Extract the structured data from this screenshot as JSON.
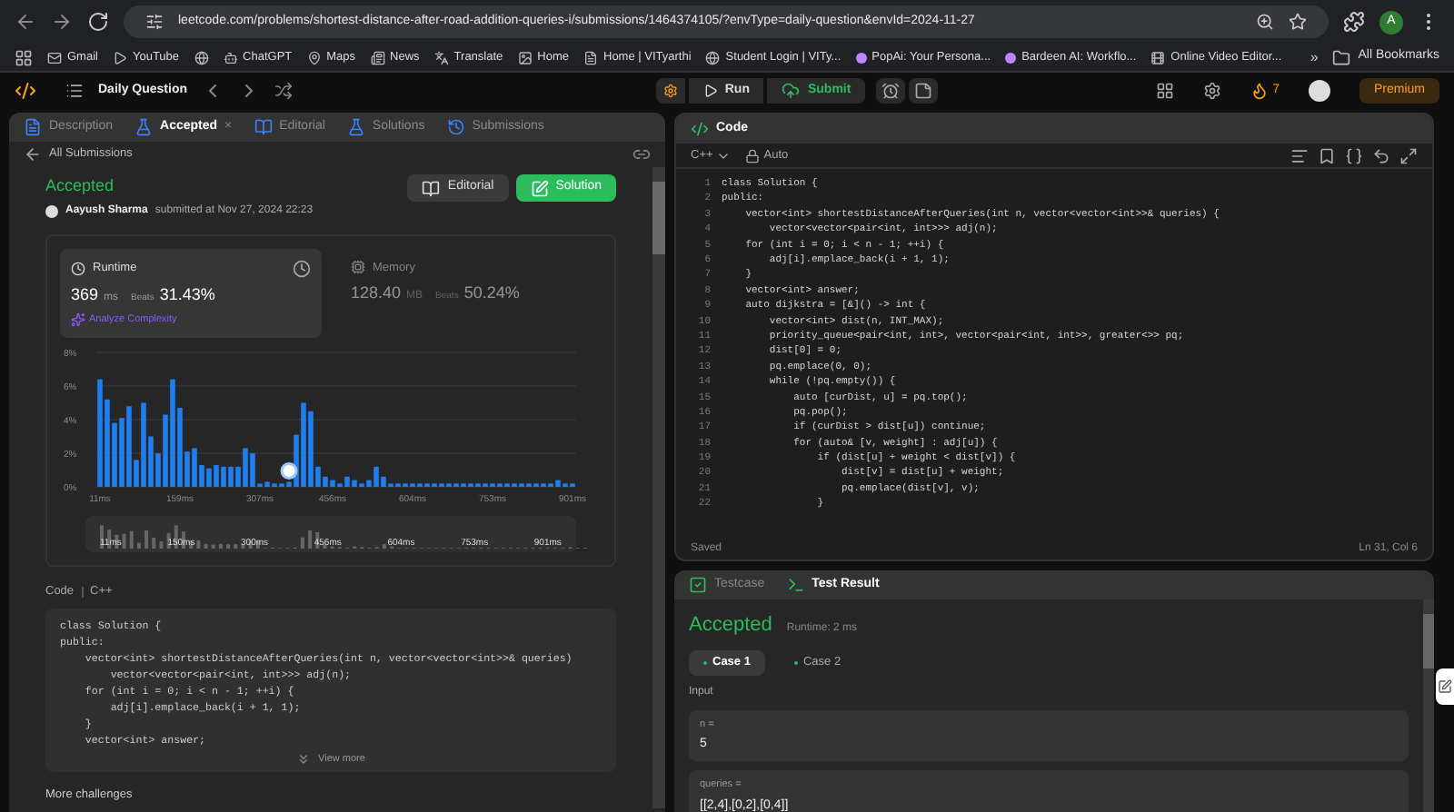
{
  "browser": {
    "url": "leetcode.com/problems/shortest-distance-after-road-addition-queries-i/submissions/1464374105/?envType=daily-question&envId=2024-11-27",
    "profile": "A",
    "bookmarks": [
      {
        "label": "Gmail",
        "kind": "mail"
      },
      {
        "label": "YouTube",
        "kind": "play"
      },
      {
        "kind": "globe"
      },
      {
        "label": "ChatGPT",
        "kind": "bot"
      },
      {
        "label": "Maps",
        "kind": "pin"
      },
      {
        "label": "News",
        "kind": "news"
      },
      {
        "label": "Translate",
        "kind": "translate"
      },
      {
        "label": "Home",
        "kind": "image"
      },
      {
        "label": "Home | VITyarthi",
        "kind": "page"
      },
      {
        "label": "Student Login | VITy...",
        "kind": "globe"
      },
      {
        "label": "PopAi: Your Persona...",
        "kind": "dot"
      },
      {
        "label": "Bardeen AI: Workflo...",
        "kind": "dot"
      },
      {
        "label": "Online Video Editor...",
        "kind": "film"
      }
    ],
    "more": "»",
    "all_bookmarks": "All Bookmarks"
  },
  "nav": {
    "title": "Daily Question",
    "run": "Run",
    "submit": "Submit",
    "streak": "7",
    "premium": "Premium"
  },
  "left": {
    "tabs": [
      {
        "label": "Description",
        "selected": false
      },
      {
        "label": "Accepted",
        "selected": true,
        "close": "×"
      },
      {
        "label": "Editorial",
        "selected": false
      },
      {
        "label": "Solutions",
        "selected": false
      },
      {
        "label": "Submissions",
        "selected": false
      }
    ],
    "back": "All Submissions",
    "status": "Accepted",
    "user": "Aayush Sharma",
    "submitted": "submitted at Nov 27, 2024 22:23",
    "editorial_button": "Editorial",
    "solution_button": "Solution",
    "metrics": [
      {
        "title": "Runtime",
        "value": "369",
        "unit": "ms",
        "beats_label": "Beats",
        "beats": "31.43%",
        "selected": true,
        "link": "Analyze Complexity"
      },
      {
        "title": "Memory",
        "value": "128.40",
        "unit": "MB",
        "beats_label": "Beats",
        "beats": "50.24%",
        "selected": false
      }
    ],
    "chart_data": {
      "type": "bar",
      "yticks": [
        {
          "value": 0,
          "label": "0%"
        },
        {
          "value": 2,
          "label": "2%"
        },
        {
          "value": 4,
          "label": "4%"
        },
        {
          "value": 6,
          "label": "6%"
        },
        {
          "value": 8,
          "label": "8%"
        }
      ],
      "categories": [
        "11ms",
        null,
        null,
        null,
        null,
        null,
        null,
        null,
        null,
        null,
        null,
        "159ms",
        null,
        null,
        null,
        null,
        null,
        null,
        null,
        null,
        null,
        null,
        "307ms",
        null,
        null,
        null,
        null,
        null,
        null,
        null,
        null,
        null,
        "456ms",
        null,
        null,
        null,
        null,
        null,
        null,
        null,
        null,
        null,
        null,
        "604ms",
        null,
        null,
        null,
        null,
        null,
        null,
        null,
        null,
        null,
        null,
        "753ms",
        null,
        null,
        null,
        null,
        null,
        null,
        null,
        null,
        null,
        null,
        "901ms"
      ],
      "ylim": [
        0,
        8
      ],
      "grid": true,
      "values": [
        6.4,
        5.2,
        3.8,
        4.1,
        4.8,
        1.6,
        5.0,
        3.0,
        2.0,
        4.3,
        6.4,
        4.7,
        2.1,
        2.3,
        1.3,
        1.1,
        1.3,
        1.2,
        1.2,
        1.2,
        2.3,
        2.0,
        0.2,
        0.3,
        0.2,
        0.2,
        0.3,
        3.1,
        5.0,
        4.5,
        1.2,
        0.6,
        0.4,
        0.2,
        0.6,
        0.4,
        0.2,
        0.4,
        1.2,
        0.6,
        0.2,
        0.2,
        0.2,
        0.2,
        0.2,
        0.2,
        0.2,
        0.2,
        0.2,
        0.2,
        0.2,
        0.2,
        0.2,
        0.2,
        0.2,
        0.2,
        0.2,
        0.2,
        0.2,
        0.2,
        0.2,
        0.2,
        0.2,
        0.4,
        0.2,
        0.2
      ]
    },
    "brush_labels": [
      "11ms",
      "150ms",
      "300ms",
      "456ms",
      "604ms",
      "753ms",
      "901ms"
    ],
    "code_label": "Code",
    "code_lang": "C++",
    "code": [
      "class Solution {",
      "public:",
      "    vector<int> shortestDistanceAfterQueries(int n, vector<vector<int>>& queries)",
      "        vector<vector<pair<int, int>>> adj(n);",
      "    for (int i = 0; i < n - 1; ++i) {",
      "        adj[i].emplace_back(i + 1, 1);",
      "    }",
      "    vector<int> answer;"
    ],
    "view_more": "View more",
    "more_challenges": "More challenges"
  },
  "editor": {
    "tab": "Code",
    "language": "C++",
    "mode": "Auto",
    "lines": [
      {
        "n": "1",
        "code": "class Solution {"
      },
      {
        "n": "2",
        "code": "public:"
      },
      {
        "n": "3",
        "code": "    vector<int> shortestDistanceAfterQueries(int n, vector<vector<int>>& queries) {"
      },
      {
        "n": "4",
        "code": "        vector<vector<pair<int, int>>> adj(n);"
      },
      {
        "n": "5",
        "code": "    for (int i = 0; i < n - 1; ++i) {"
      },
      {
        "n": "6",
        "code": "        adj[i].emplace_back(i + 1, 1);"
      },
      {
        "n": "7",
        "code": "    }"
      },
      {
        "n": "8",
        "code": "    vector<int> answer;"
      },
      {
        "n": "9",
        "code": "    auto dijkstra = [&]() -> int {"
      },
      {
        "n": "10",
        "code": "        vector<int> dist(n, INT_MAX);"
      },
      {
        "n": "11",
        "code": "        priority_queue<pair<int, int>, vector<pair<int, int>>, greater<>> pq;"
      },
      {
        "n": "12",
        "code": "        dist[0] = 0;"
      },
      {
        "n": "13",
        "code": "        pq.emplace(0, 0);"
      },
      {
        "n": "14",
        "code": "        while (!pq.empty()) {"
      },
      {
        "n": "15",
        "code": "            auto [curDist, u] = pq.top();"
      },
      {
        "n": "16",
        "code": "            pq.pop();"
      },
      {
        "n": "17",
        "code": "            if (curDist > dist[u]) continue;"
      },
      {
        "n": "18",
        "code": "            for (auto& [v, weight] : adj[u]) {"
      },
      {
        "n": "19",
        "code": "                if (dist[u] + weight < dist[v]) {"
      },
      {
        "n": "20",
        "code": "                    dist[v] = dist[u] + weight;"
      },
      {
        "n": "21",
        "code": "                    pq.emplace(dist[v], v);"
      },
      {
        "n": "22",
        "code": "                }"
      }
    ],
    "saved": "Saved",
    "position": "Ln 31, Col 6"
  },
  "result": {
    "tabs": [
      {
        "label": "Testcase",
        "selected": false
      },
      {
        "label": "Test Result",
        "selected": true
      }
    ],
    "status": "Accepted",
    "runtime": "Runtime: 2 ms",
    "cases": [
      {
        "label": "Case 1",
        "selected": true
      },
      {
        "label": "Case 2",
        "selected": false
      }
    ],
    "input_label": "Input",
    "inputs": [
      {
        "name": "n =",
        "value": "5"
      },
      {
        "name": "queries =",
        "value": "[[2,4],[0,2],[0,4]]"
      }
    ]
  }
}
